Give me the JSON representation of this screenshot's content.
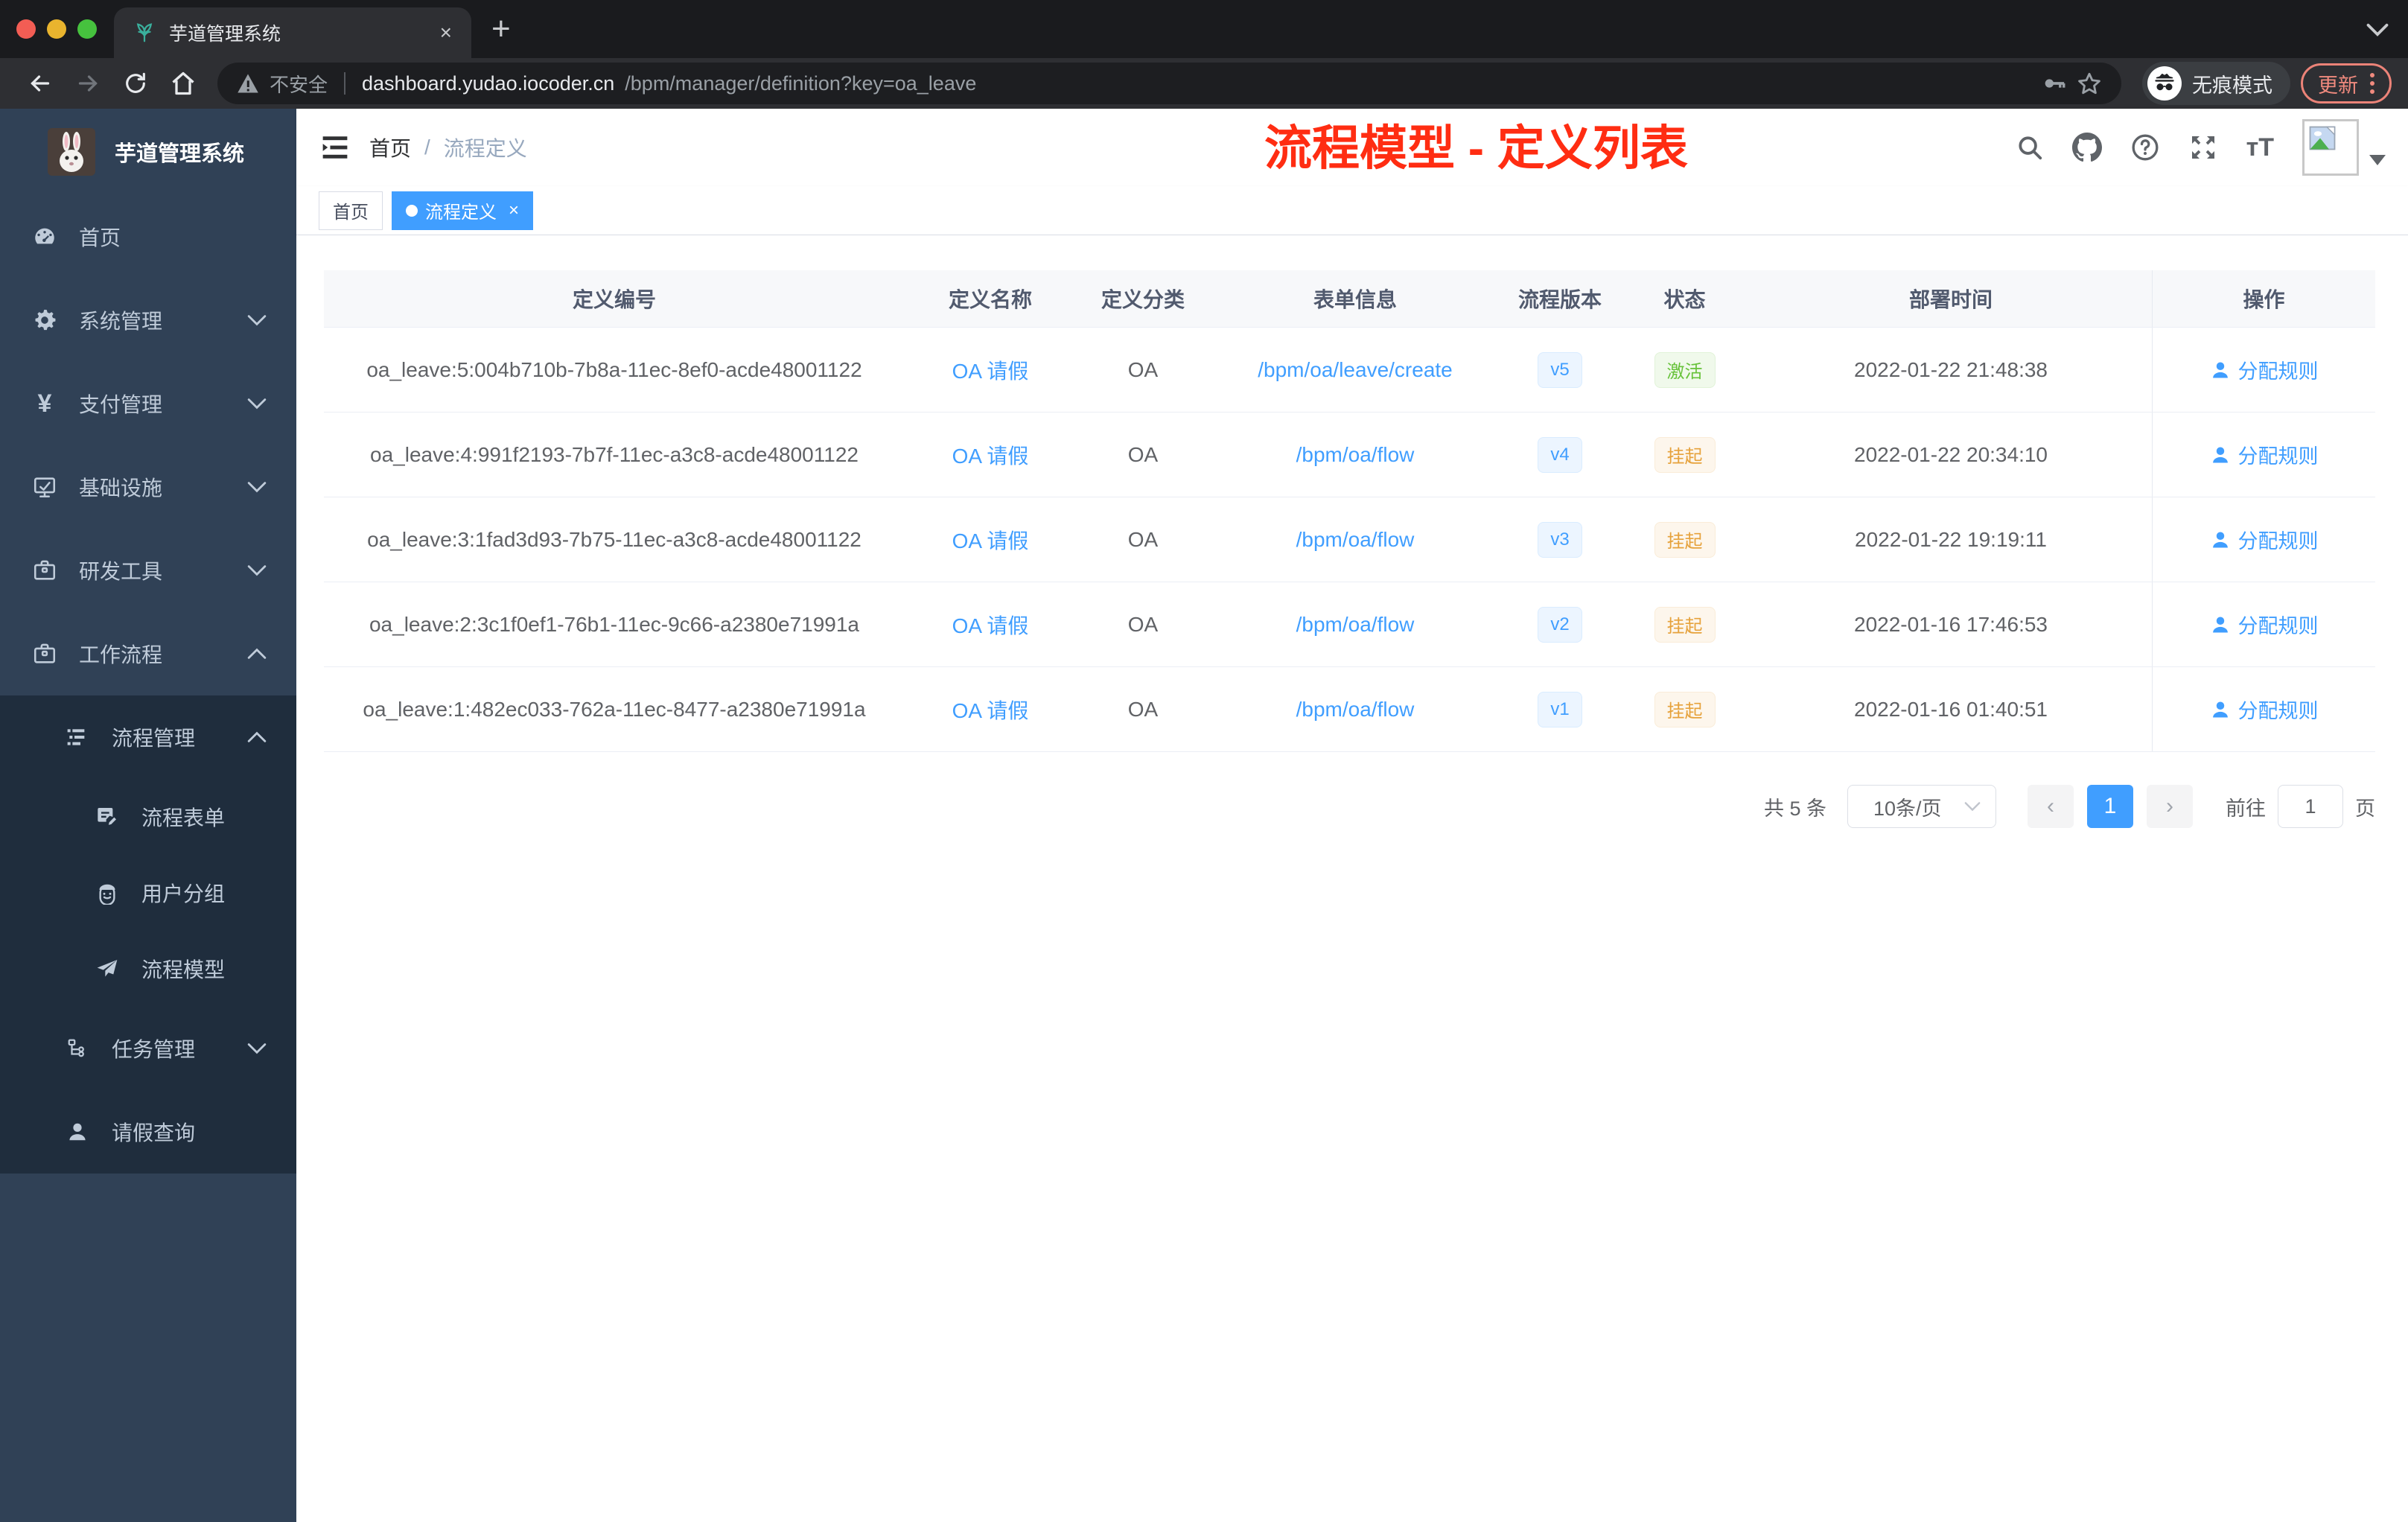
{
  "browser": {
    "tab_title": "芋道管理系统",
    "new_tab": "+",
    "close_tab": "×",
    "security_label": "不安全",
    "url_host": "dashboard.yudao.iocoder.cn",
    "url_path": "/bpm/manager/definition?key=oa_leave",
    "incognito_label": "无痕模式",
    "update_label": "更新",
    "icons": [
      "back-icon",
      "forward-icon",
      "reload-icon",
      "home-icon",
      "warning-icon",
      "key-icon",
      "star-icon",
      "incognito-icon",
      "kebab-menu-icon",
      "tab-search-chevron-icon"
    ]
  },
  "sidebar": {
    "logo_title": "芋道管理系统",
    "items": [
      {
        "label": "首页",
        "icon": "gauge-icon"
      },
      {
        "label": "系统管理",
        "icon": "gear-icon",
        "chevron": "down"
      },
      {
        "label": "支付管理",
        "icon": "yen-icon",
        "chevron": "down"
      },
      {
        "label": "基础设施",
        "icon": "monitor-icon",
        "chevron": "down"
      },
      {
        "label": "研发工具",
        "icon": "toolbox-icon",
        "chevron": "down"
      },
      {
        "label": "工作流程",
        "icon": "toolbox-icon",
        "chevron": "up"
      },
      {
        "label": "流程管理",
        "icon": "tree-table-icon",
        "chevron": "up"
      },
      {
        "label": "流程表单",
        "icon": "form-icon"
      },
      {
        "label": "用户分组",
        "icon": "robot-icon"
      },
      {
        "label": "流程模型",
        "icon": "paper-plane-icon"
      },
      {
        "label": "任务管理",
        "icon": "tree-icon",
        "chevron": "down"
      },
      {
        "label": "请假查询",
        "icon": "user-icon"
      }
    ]
  },
  "navbar": {
    "breadcrumb_home": "首页",
    "breadcrumb_sep": "/",
    "breadcrumb_current": "流程定义",
    "annotation": "流程模型 - 定义列表",
    "icons": [
      "search-icon",
      "github-icon",
      "help-icon",
      "fullscreen-icon",
      "font-size-icon",
      "avatar",
      "caret-down-icon"
    ]
  },
  "tags": {
    "home": "首页",
    "active": "流程定义",
    "close": "×"
  },
  "table": {
    "columns": [
      "定义编号",
      "定义名称",
      "定义分类",
      "表单信息",
      "流程版本",
      "状态",
      "部署时间",
      "操作"
    ],
    "rows": [
      {
        "id": "oa_leave:5:004b710b-7b8a-11ec-8ef0-acde48001122",
        "name": "OA 请假",
        "category": "OA",
        "form": "/bpm/oa/leave/create",
        "version": "v5",
        "status": "激活",
        "status_type": "success",
        "time": "2022-01-22 21:48:38",
        "action": "分配规则"
      },
      {
        "id": "oa_leave:4:991f2193-7b7f-11ec-a3c8-acde48001122",
        "name": "OA 请假",
        "category": "OA",
        "form": "/bpm/oa/flow",
        "version": "v4",
        "status": "挂起",
        "status_type": "warning",
        "time": "2022-01-22 20:34:10",
        "action": "分配规则"
      },
      {
        "id": "oa_leave:3:1fad3d93-7b75-11ec-a3c8-acde48001122",
        "name": "OA 请假",
        "category": "OA",
        "form": "/bpm/oa/flow",
        "version": "v3",
        "status": "挂起",
        "status_type": "warning",
        "time": "2022-01-22 19:19:11",
        "action": "分配规则"
      },
      {
        "id": "oa_leave:2:3c1f0ef1-76b1-11ec-9c66-a2380e71991a",
        "name": "OA 请假",
        "category": "OA",
        "form": "/bpm/oa/flow",
        "version": "v2",
        "status": "挂起",
        "status_type": "warning",
        "time": "2022-01-16 17:46:53",
        "action": "分配规则"
      },
      {
        "id": "oa_leave:1:482ec033-762a-11ec-8477-a2380e71991a",
        "name": "OA 请假",
        "category": "OA",
        "form": "/bpm/oa/flow",
        "version": "v1",
        "status": "挂起",
        "status_type": "warning",
        "time": "2022-01-16 01:40:51",
        "action": "分配规则"
      }
    ]
  },
  "pagination": {
    "total": "共 5 条",
    "page_size": "10条/页",
    "prev": "‹",
    "current_page": "1",
    "next": "›",
    "goto_label": "前往",
    "goto_value": "1",
    "page_unit": "页"
  },
  "colors": {
    "accent": "#409eff",
    "success": "#67c23a",
    "warning": "#e6a23c",
    "annotation_red": "#ff2d12",
    "sidebar_bg": "#304156",
    "submenu_bg": "#1f2d3d"
  }
}
